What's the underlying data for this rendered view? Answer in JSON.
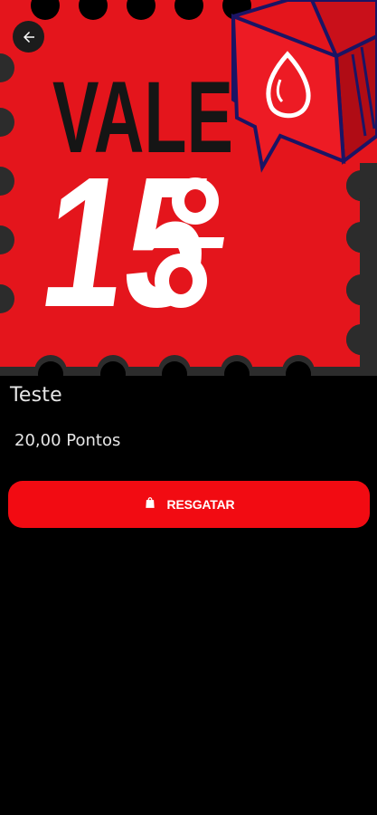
{
  "banner": {
    "word": "VALE",
    "number": "15",
    "symbol": "%",
    "colors": {
      "stamp_red": "#e4151c",
      "dark": "#1a1a1a"
    }
  },
  "header": {
    "back_icon": "arrow-left-icon"
  },
  "product": {
    "title": "Teste",
    "points": "20,00 Pontos"
  },
  "actions": {
    "redeem_label": "RESGATAR",
    "redeem_icon": "shopping-bag-icon",
    "accent": "#f20b12"
  }
}
